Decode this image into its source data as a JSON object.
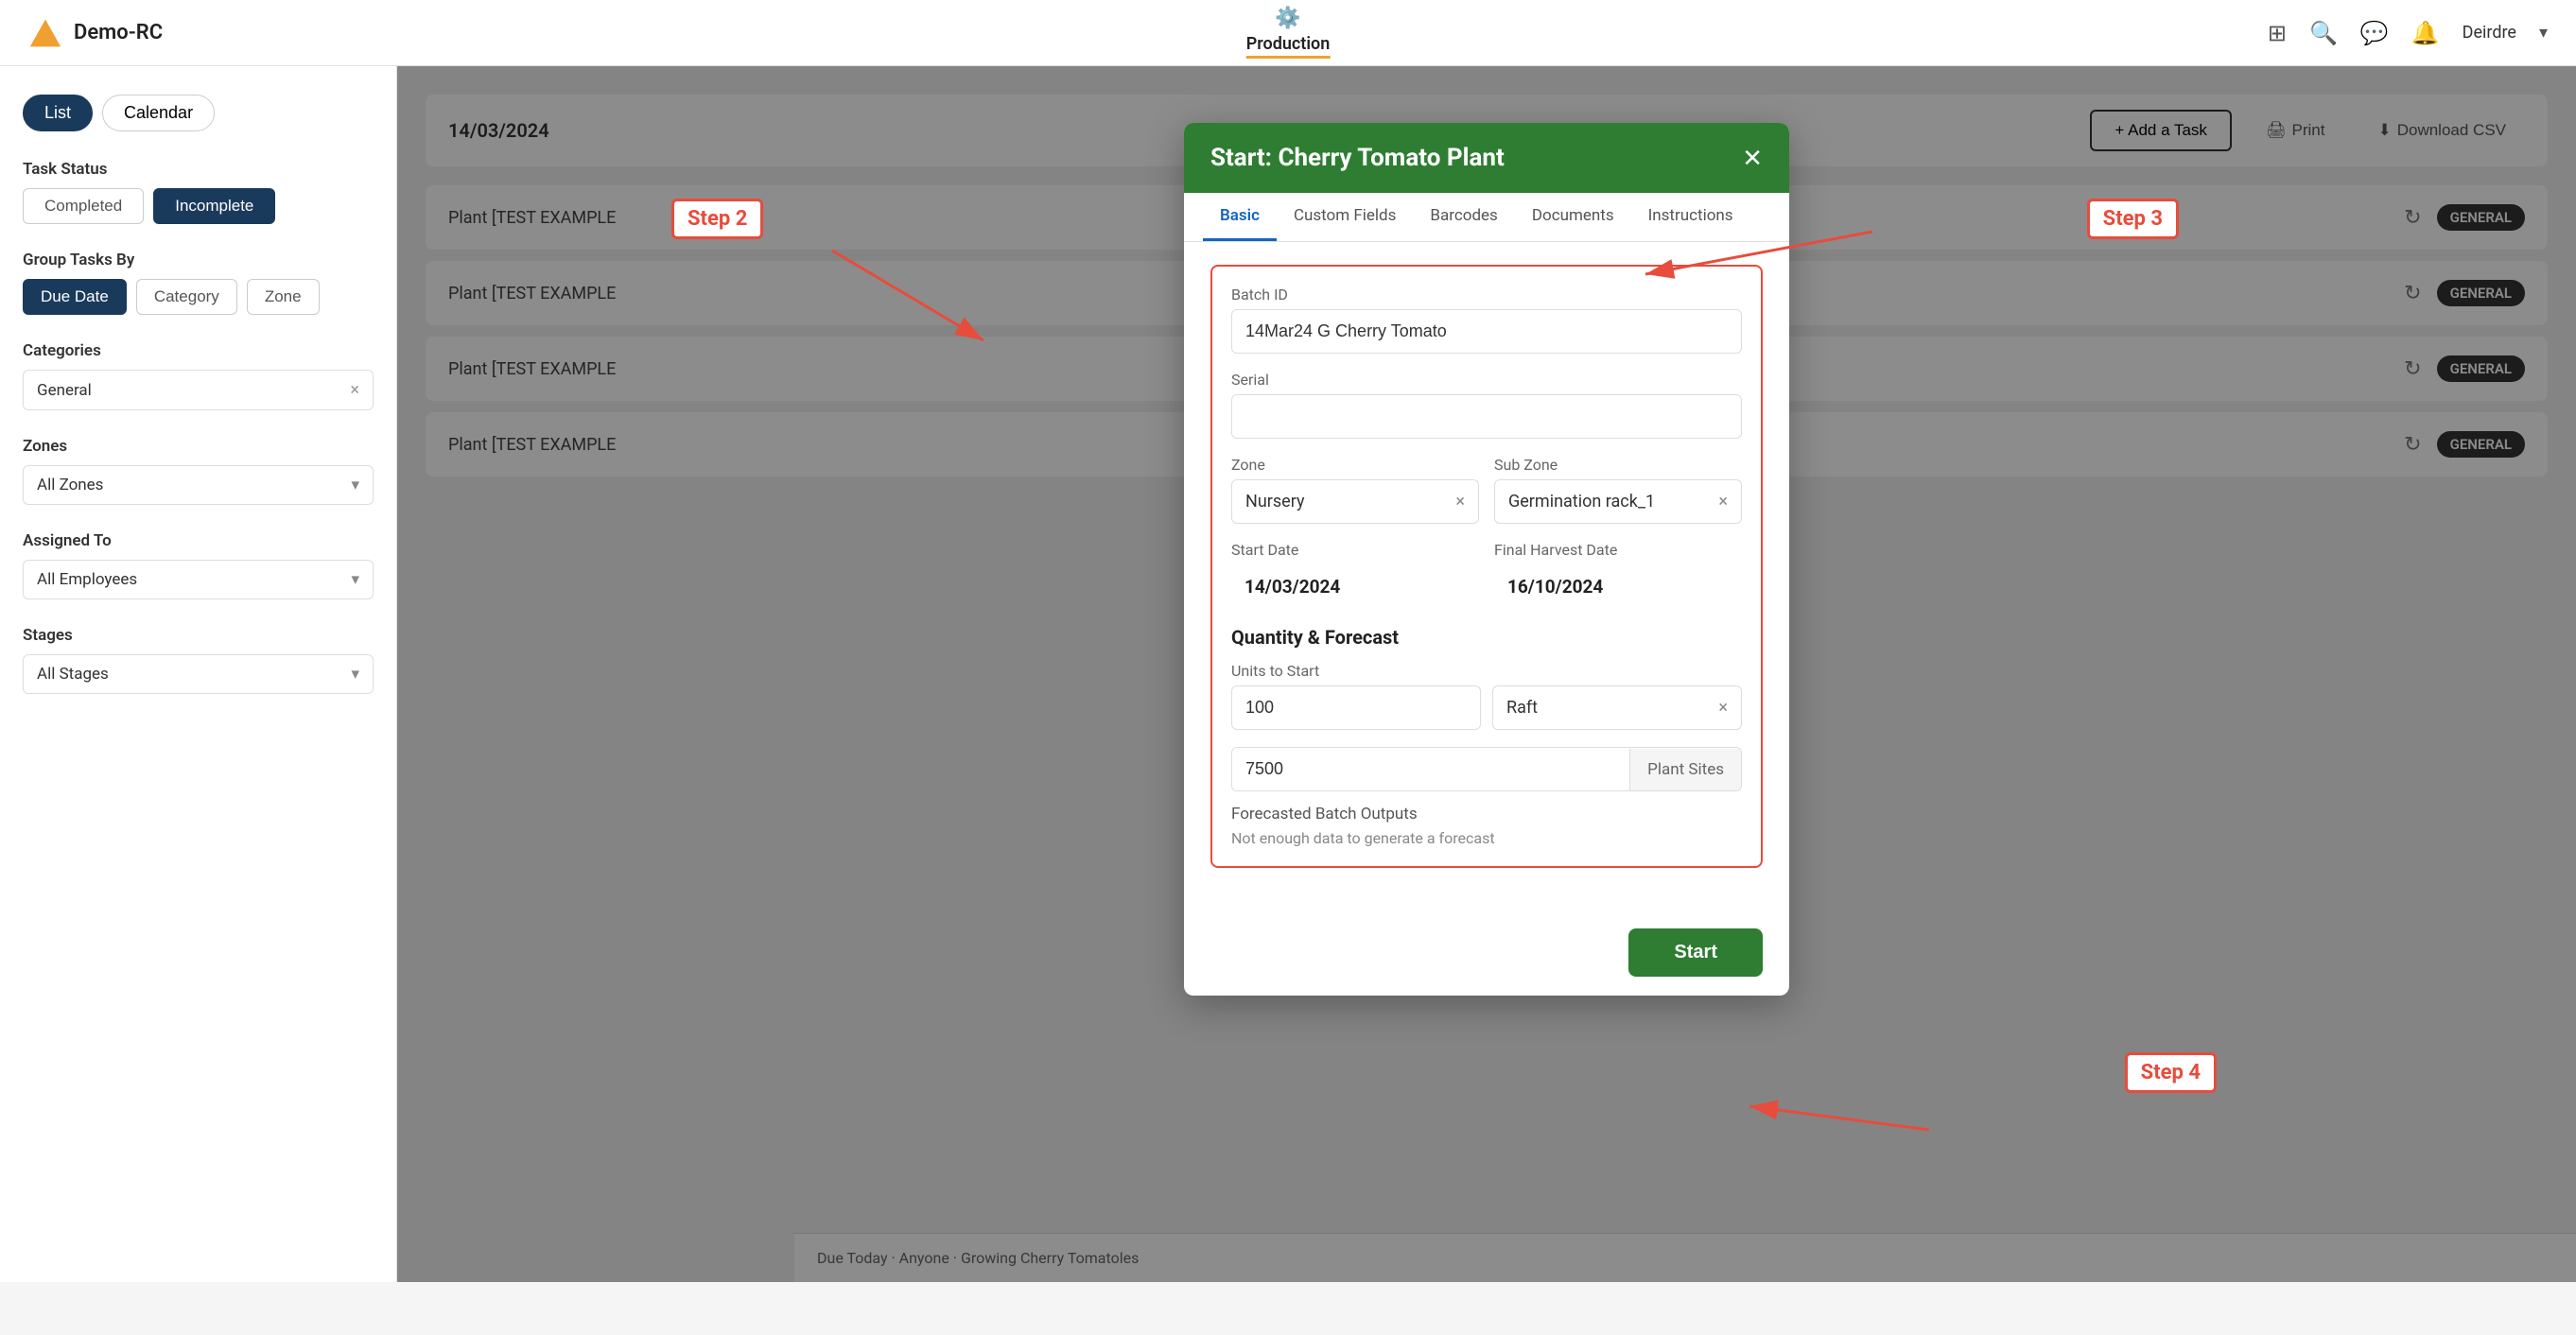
{
  "app": {
    "name": "Demo-RC",
    "logo_color": "#f0a030"
  },
  "topnav": {
    "production_label": "Production",
    "user_label": "Deirdre",
    "user_caret": "▾"
  },
  "subnav": {
    "date_label": "14/03/2024",
    "add_task_label": "+ Add a Task",
    "print_label": "Print",
    "download_csv_label": "Download CSV"
  },
  "sidebar": {
    "list_label": "List",
    "calendar_label": "Calendar",
    "task_status_label": "Task Status",
    "completed_label": "Completed",
    "incomplete_label": "Incomplete",
    "group_tasks_label": "Group Tasks By",
    "due_date_label": "Due Date",
    "category_label": "Category",
    "zone_label": "Zone",
    "categories_label": "Categories",
    "categories_value": "General",
    "zones_label": "Zones",
    "zones_value": "All Zones",
    "assigned_label": "Assigned To",
    "assigned_value": "All Employees",
    "stages_label": "Stages",
    "stages_value": "All Stages"
  },
  "tasks": [
    {
      "text": "Plant [TEST EXAMPLE",
      "badge": "GENERAL"
    },
    {
      "text": "Plant [TEST EXAMPLE",
      "badge": "GENERAL"
    },
    {
      "text": "Plant [TEST EXAMPLE",
      "badge": "GENERAL"
    },
    {
      "text": "Plant [TEST EXAMPLE",
      "badge": "GENERAL"
    }
  ],
  "modal": {
    "title": "Start: Cherry Tomato Plant",
    "close_label": "✕",
    "tabs": [
      {
        "label": "Basic",
        "active": true
      },
      {
        "label": "Custom Fields"
      },
      {
        "label": "Barcodes"
      },
      {
        "label": "Documents"
      },
      {
        "label": "Instructions"
      }
    ],
    "batch_id_label": "Batch ID",
    "batch_id_value": "14Mar24 G Cherry Tomato",
    "serial_label": "Serial",
    "serial_value": "",
    "zone_label": "Zone",
    "zone_value": "Nursery",
    "subzone_label": "Sub Zone",
    "subzone_value": "Germination rack_1",
    "start_date_label": "Start Date",
    "start_date_value": "14/03/2024",
    "harvest_date_label": "Final Harvest Date",
    "harvest_date_value": "16/10/2024",
    "qty_section_label": "Quantity & Forecast",
    "units_label": "Units to Start",
    "units_value": "100",
    "unit_type": "Raft",
    "plant_sites_value": "7500",
    "plant_sites_label": "Plant Sites",
    "forecast_label": "Forecasted Batch Outputs",
    "forecast_text": "Not enough data to generate a forecast",
    "start_btn_label": "Start"
  },
  "annotations": {
    "step2": "Step 2",
    "step3": "Step 3",
    "step4": "Step 4"
  },
  "bottom_bar": {
    "text": "Due Today · Anyone · Growing Cherry Tomatoles"
  }
}
